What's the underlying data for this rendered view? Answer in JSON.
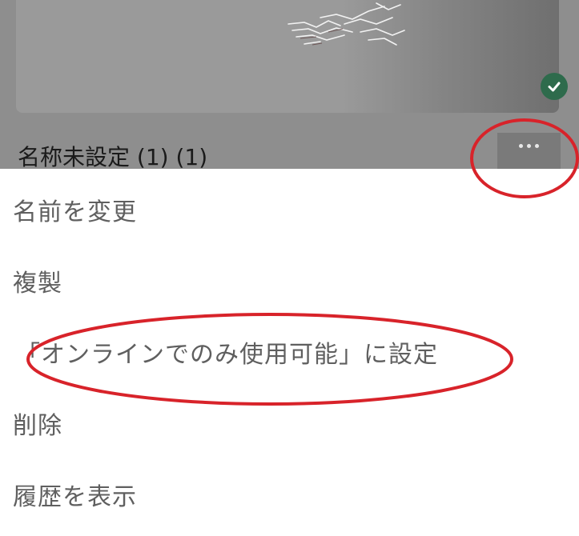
{
  "file_card": {
    "name": "名称未設定 (1) (1)",
    "sync_icon": "check-circle-icon",
    "more_icon": "ellipsis-icon"
  },
  "menu": {
    "items": [
      {
        "label": "名前を変更"
      },
      {
        "label": "複製"
      },
      {
        "label": "「オンラインでのみ使用可能」に設定"
      },
      {
        "label": "削除"
      },
      {
        "label": "履歴を表示"
      }
    ]
  },
  "colors": {
    "dim_overlay": "#8e8e8e",
    "sync_check": "#2e6b4c",
    "annotation": "#d8232a",
    "menu_text": "#5f5f5f"
  }
}
